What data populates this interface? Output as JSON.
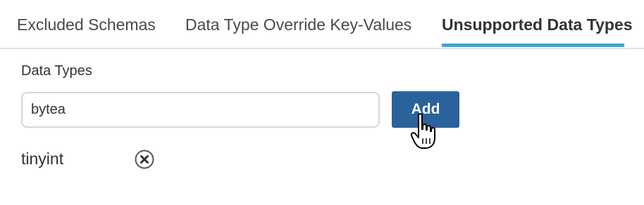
{
  "tabs": [
    {
      "label": "Excluded Schemas",
      "active": false
    },
    {
      "label": "Data Type Override Key-Values",
      "active": false
    },
    {
      "label": "Unsupported Data Types",
      "active": true
    }
  ],
  "colors": {
    "active_tab_underline": "#3ba6d6",
    "primary_button": "#2a629c"
  },
  "form": {
    "label": "Data Types",
    "input_value": "bytea",
    "add_button_label": "Add"
  },
  "items": [
    {
      "label": "tinyint",
      "remove_icon": "circle-x-icon"
    }
  ],
  "cursor": {
    "icon": "hand-pointer-icon"
  }
}
